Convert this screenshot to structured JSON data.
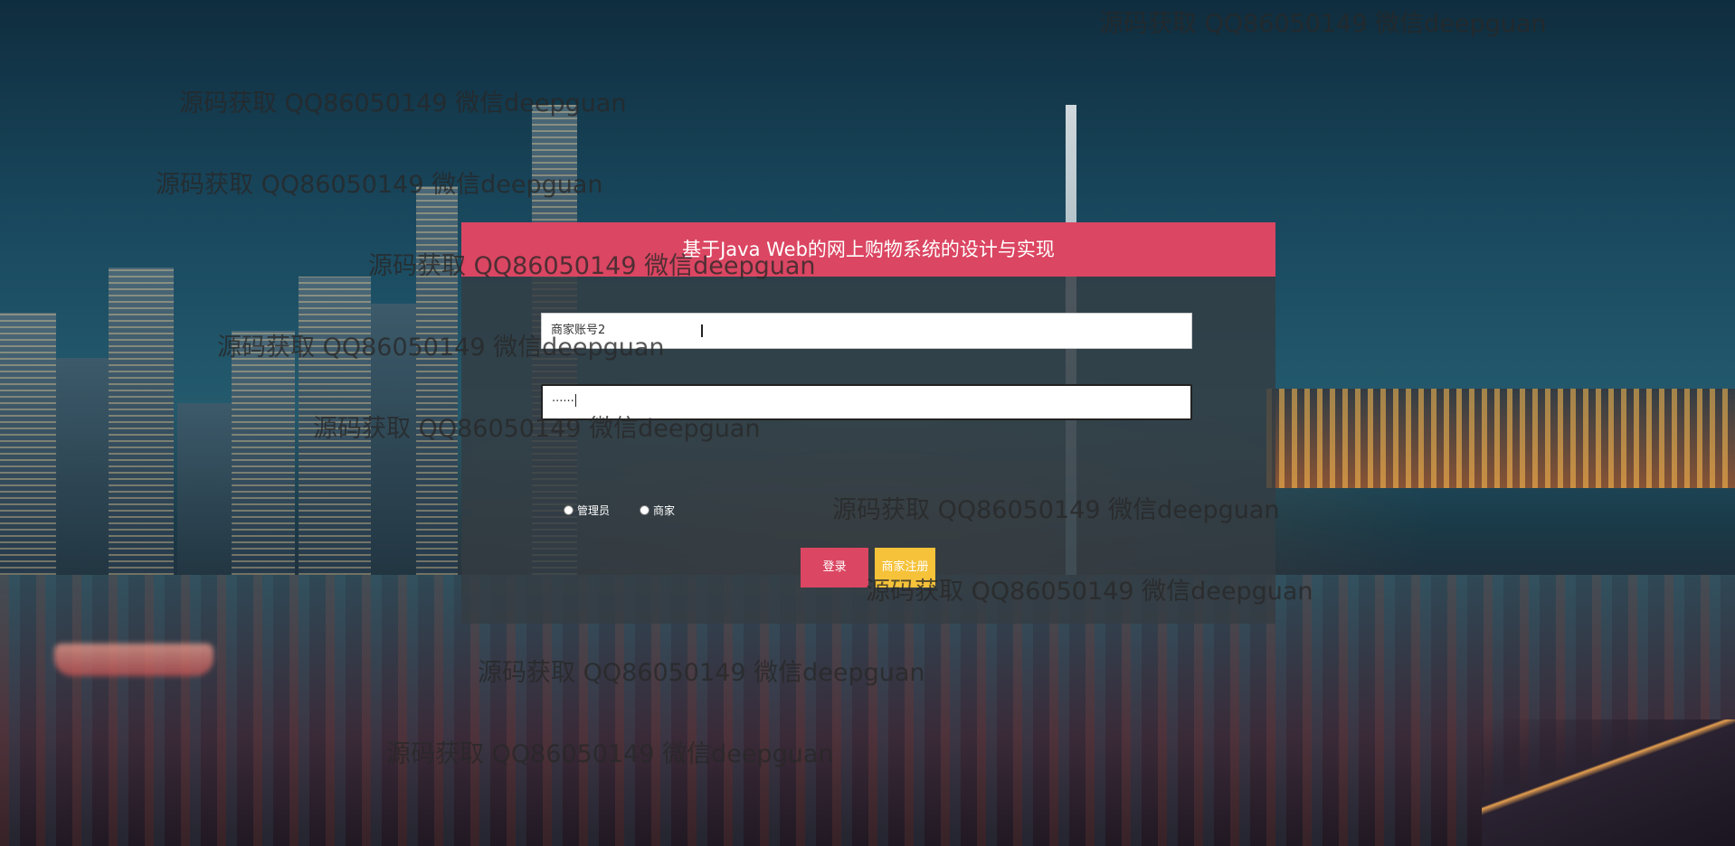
{
  "login": {
    "title": "基于Java Web的网上购物系统的设计与实现",
    "username_value": "商家账号2",
    "password_value": "······",
    "roles": [
      "管理员",
      "商家"
    ],
    "login_label": "登录",
    "register_label": "商家注册"
  },
  "watermarks": [
    "源码获取 QQ86050149 微信deepguan",
    "源码获取 QQ86050149 微信deepguan",
    "源码获取 QQ86050149 微信deepguan",
    "源码获取 QQ86050149 微信deepguan",
    "源码获取 QQ86050149 微信deepguan",
    "源码获取 QQ86050149 微信deepguan",
    "源码获取 QQ86050149 微信deepguan",
    "源码获取 QQ86050149 微信deepguan",
    "源码获取 QQ86050149 微信deepguan",
    "源码获取 QQ86050149 微信deepguan"
  ],
  "colors": {
    "header": "#db4662",
    "login_button": "#db4662",
    "register_button": "#f5c23a"
  }
}
